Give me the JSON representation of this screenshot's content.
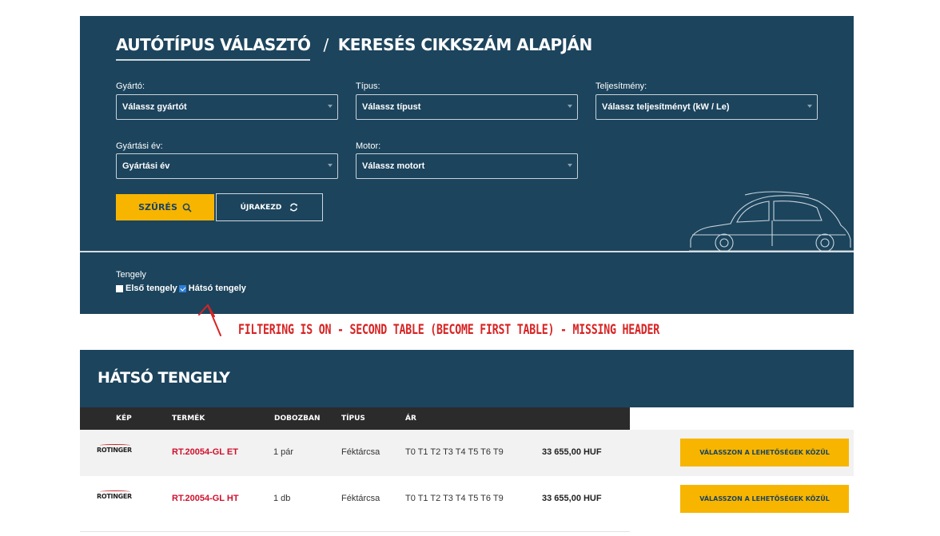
{
  "search": {
    "tab_active": "AUTÓTÍPUS VÁLASZTÓ",
    "separator": "/",
    "tab_inactive": "KERESÉS CIKKSZÁM ALAPJÁN",
    "fields": {
      "manufacturer": {
        "label": "Gyártó:",
        "value": "Válassz gyártót"
      },
      "type": {
        "label": "Típus:",
        "value": "Válassz típust"
      },
      "power": {
        "label": "Teljesítmény:",
        "value": "Válassz teljesítményt (kW / Le)"
      },
      "year": {
        "label": "Gyártási év:",
        "value": "Gyártási év"
      },
      "engine": {
        "label": "Motor:",
        "value": "Válassz motort"
      }
    },
    "filter_button": "SZŰRÉS",
    "reset_button": "ÚJRAKEZD"
  },
  "axle": {
    "title": "Tengely",
    "options": [
      {
        "label": "Első tengely",
        "checked": false
      },
      {
        "label": "Hátsó tengely",
        "checked": true
      }
    ]
  },
  "annotation": "FILTERING IS ON - SECOND TABLE (BECOME FIRST TABLE) - MISSING HEADER",
  "results": {
    "section_title": "HÁTSÓ TENGELY",
    "columns": {
      "image": "KÉP",
      "product": "TERMÉK",
      "box": "DOBOZBAN",
      "type": "TÍPUS",
      "price": "ÁR"
    },
    "rows": [
      {
        "logo": "ROTINGER",
        "sku": "RT.20054-GL ET",
        "qty": "1 pár",
        "type": "Féktárcsa",
        "variants": "T0 T1 T2 T3 T4 T5 T6 T9",
        "price": "33 655,00 HUF",
        "button": "VÁLASSZON A LEHETŐSÉGEK KÖZÜL"
      },
      {
        "logo": "ROTINGER",
        "sku": "RT.20054-GL HT",
        "qty": "1 db",
        "type": "Féktárcsa",
        "variants": "T0 T1 T2 T3 T4 T5 T6 T9",
        "price": "33 655,00 HUF",
        "button": "VÁLASSZON A LEHETŐSÉGEK KÖZÜL"
      }
    ]
  },
  "colors": {
    "panel": "#1c445d",
    "accent": "#f7b500",
    "sku_red": "#d0102b",
    "annotation_red": "#d82323"
  }
}
